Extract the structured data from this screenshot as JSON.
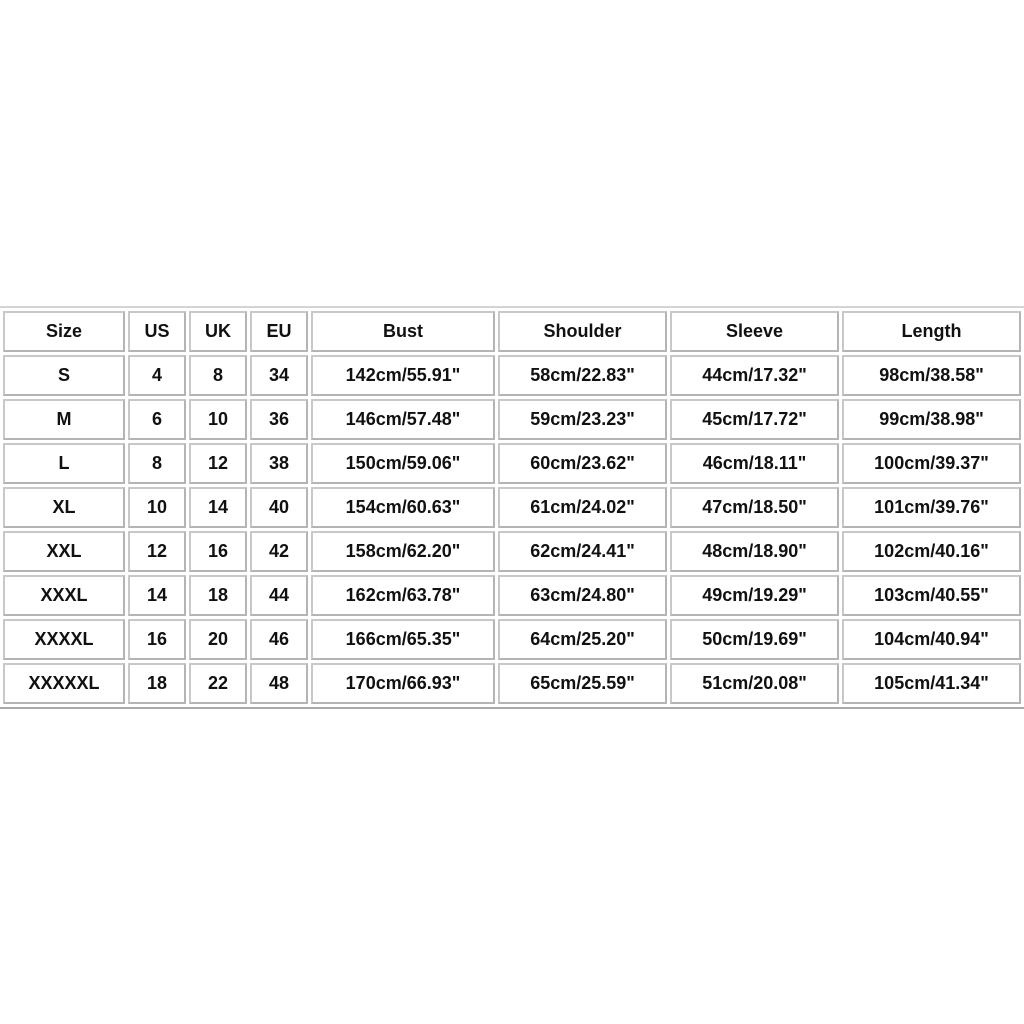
{
  "table": {
    "headers": [
      "Size",
      "US",
      "UK",
      "EU",
      "Bust",
      "Shoulder",
      "Sleeve",
      "Length"
    ],
    "rows": [
      [
        "S",
        "4",
        "8",
        "34",
        "142cm/55.91\"",
        "58cm/22.83\"",
        "44cm/17.32\"",
        "98cm/38.58\""
      ],
      [
        "M",
        "6",
        "10",
        "36",
        "146cm/57.48\"",
        "59cm/23.23\"",
        "45cm/17.72\"",
        "99cm/38.98\""
      ],
      [
        "L",
        "8",
        "12",
        "38",
        "150cm/59.06\"",
        "60cm/23.62\"",
        "46cm/18.11\"",
        "100cm/39.37\""
      ],
      [
        "XL",
        "10",
        "14",
        "40",
        "154cm/60.63\"",
        "61cm/24.02\"",
        "47cm/18.50\"",
        "101cm/39.76\""
      ],
      [
        "XXL",
        "12",
        "16",
        "42",
        "158cm/62.20\"",
        "62cm/24.41\"",
        "48cm/18.90\"",
        "102cm/40.16\""
      ],
      [
        "XXXL",
        "14",
        "18",
        "44",
        "162cm/63.78\"",
        "63cm/24.80\"",
        "49cm/19.29\"",
        "103cm/40.55\""
      ],
      [
        "XXXXL",
        "16",
        "20",
        "46",
        "166cm/65.35\"",
        "64cm/25.20\"",
        "50cm/19.69\"",
        "104cm/40.94\""
      ],
      [
        "XXXXXL",
        "18",
        "22",
        "48",
        "170cm/66.93\"",
        "65cm/25.59\"",
        "51cm/20.08\"",
        "105cm/41.34\""
      ]
    ]
  }
}
